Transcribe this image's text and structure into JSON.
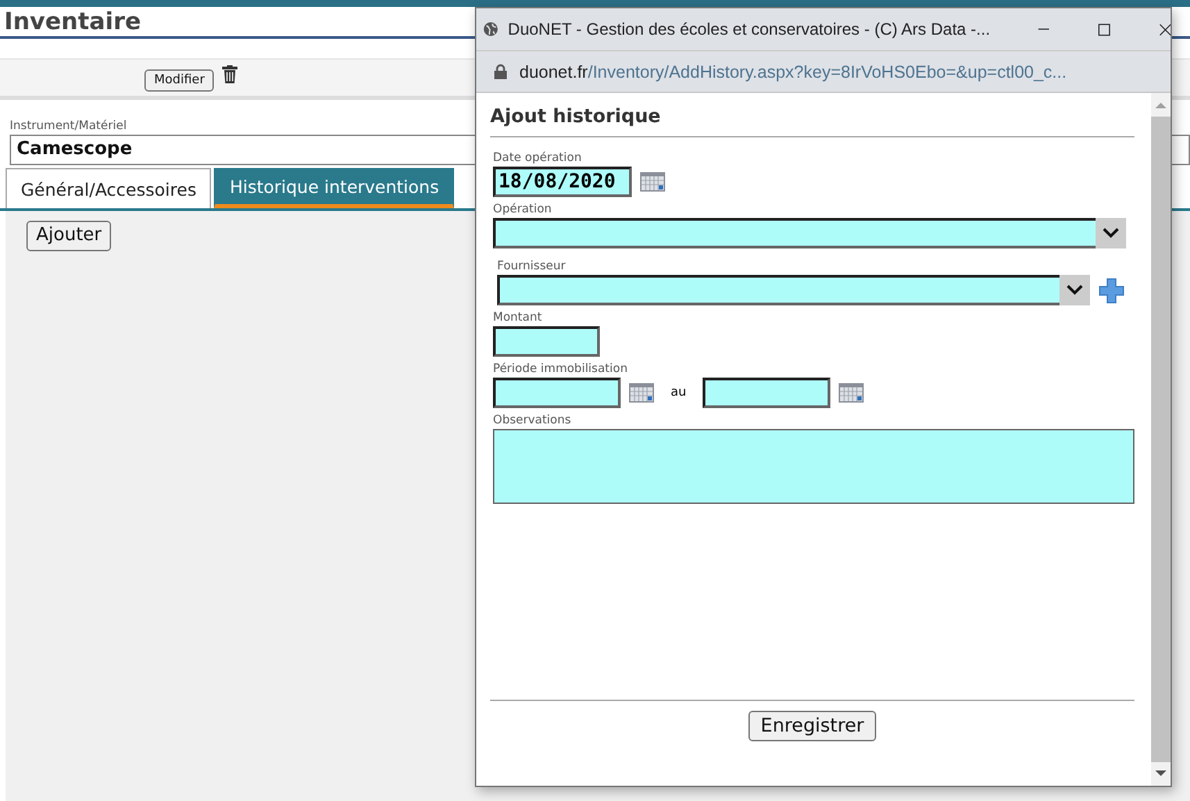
{
  "page": {
    "title": "Inventaire",
    "toolbar": {
      "edit_button": "Modifier"
    },
    "field": {
      "label": "Instrument/Matériel",
      "value": "Camescope"
    },
    "tabs": [
      {
        "label": "Général/Accessoires",
        "selected": false
      },
      {
        "label": "Historique interventions",
        "selected": true
      }
    ],
    "add_button": "Ajouter"
  },
  "popup": {
    "title": "DuoNET - Gestion des écoles et conservatoires - (C) Ars Data -...",
    "url_host": "duonet.fr",
    "url_path": "/Inventory/AddHistory.aspx?key=8IrVoHS0Ebo=&up=ctl00_c...",
    "heading": "Ajout historique",
    "fields": [
      {
        "kind": "date",
        "label": "Date opération",
        "value": "18/08/2020"
      },
      {
        "kind": "select",
        "label": "Opération",
        "addable": false
      },
      {
        "kind": "select",
        "label": "Fournisseur",
        "addable": true
      },
      {
        "kind": "text",
        "label": "Montant"
      },
      {
        "kind": "range",
        "label": "Période immobilisation",
        "separator": "au"
      },
      {
        "kind": "textarea",
        "label": "Observations"
      }
    ],
    "save_button": "Enregistrer"
  }
}
